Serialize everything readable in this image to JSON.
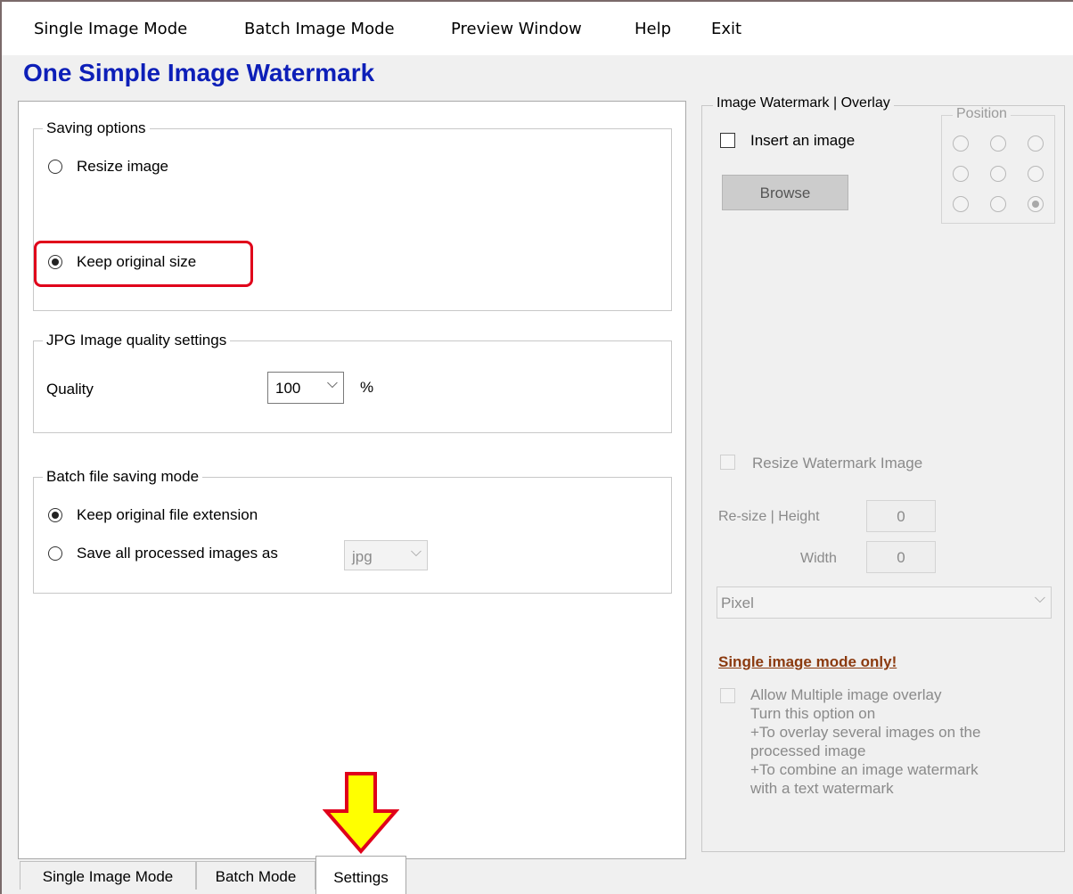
{
  "menu": {
    "items": [
      "Single Image Mode",
      "Batch Image Mode",
      "Preview Window",
      "Help",
      "Exit"
    ]
  },
  "app_title": "One Simple Image Watermark",
  "saving_options": {
    "title": "Saving options",
    "resize_label": "Resize image",
    "keep_label": "Keep original size",
    "selected": "keep_original_size"
  },
  "jpg_quality": {
    "title": "JPG Image quality settings",
    "quality_label": "Quality",
    "value": "100",
    "unit": "%"
  },
  "batch_saving": {
    "title": "Batch file saving mode",
    "keep_ext_label": "Keep original file extension",
    "save_all_label": "Save all processed images as",
    "format_value": "jpg",
    "selected": "keep_original_file_extension"
  },
  "tabs": [
    "Single Image Mode",
    "Batch Mode",
    "Settings"
  ],
  "active_tab": "Settings",
  "watermark": {
    "title": "Image Watermark | Overlay",
    "insert_label": "Insert an image",
    "insert_checked": false,
    "browse_label": "Browse",
    "position_title": "Position",
    "position_selected": "bottom-right",
    "resize_label": "Resize Watermark Image",
    "height_label": "Re-size | Height",
    "height_value": "0",
    "width_label": "Width",
    "width_value": "0",
    "unit_value": "Pixel",
    "single_mode_label": "Single image mode only!",
    "allow_multiple_label": "Allow Multiple image overlay",
    "allow_multiple_description": [
      "Turn this option on",
      "+To overlay several images on the",
      "processed image",
      "+To combine an image watermark",
      "with a text watermark"
    ]
  },
  "colors": {
    "title_blue": "#0d1fb8",
    "highlight_red": "#e0001a",
    "arrow_yellow": "#ffff00",
    "link_brown": "#8b3a0f"
  },
  "icons": {
    "dropdown": "chevron-down-icon",
    "arrow": "down-arrow-icon"
  }
}
